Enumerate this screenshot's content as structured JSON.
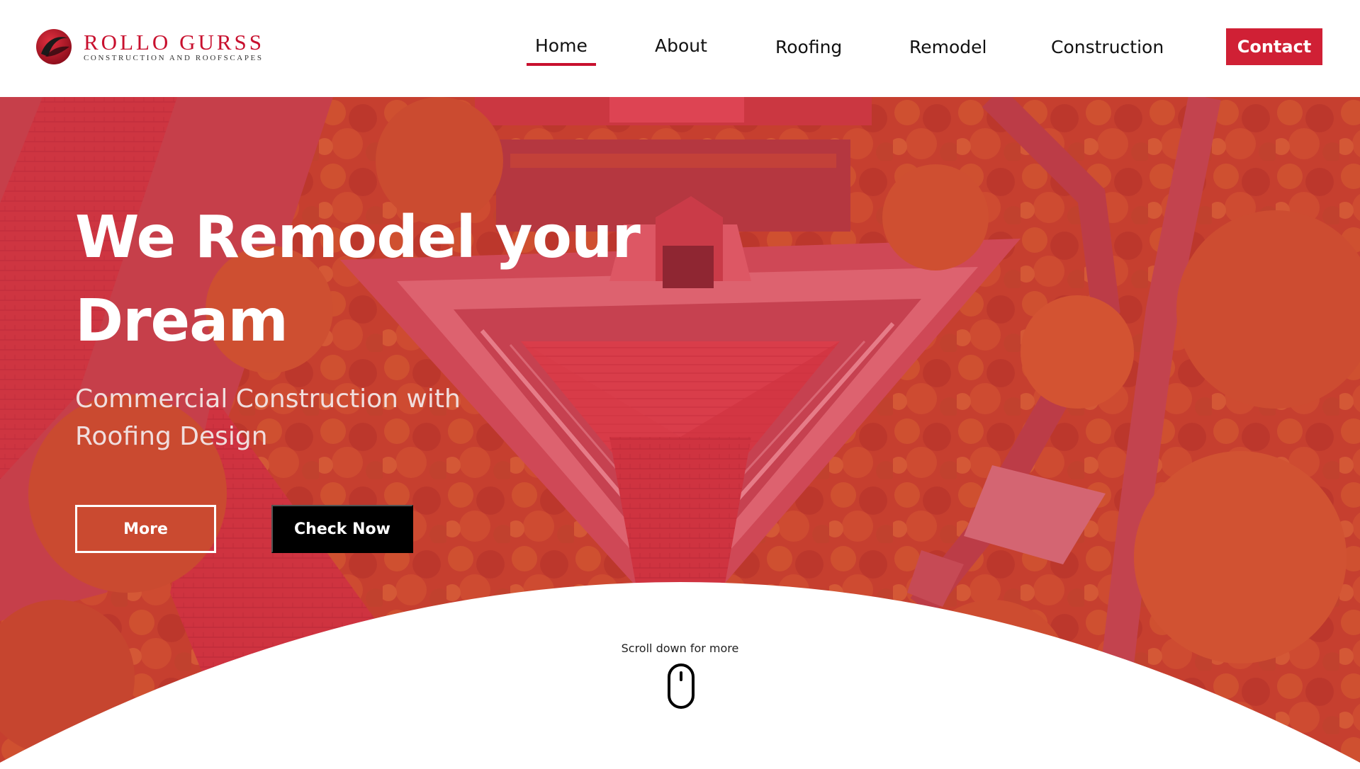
{
  "brand": {
    "name": "ROLLO GURSS",
    "tagline": "CONSTRUCTION AND ROOFSCAPES",
    "logo_icon": "logo-swoosh-icon",
    "color": "#c8102e"
  },
  "nav": {
    "items": [
      {
        "label": "Home",
        "active": true
      },
      {
        "label": "About",
        "active": false
      },
      {
        "label": "Roofing",
        "active": false
      },
      {
        "label": "Remodel",
        "active": false
      },
      {
        "label": "Construction",
        "active": false
      }
    ],
    "contact_label": "Contact",
    "contact_color": "#d02035"
  },
  "hero": {
    "title": "We Remodel your Dream",
    "subtitle": "Commercial Construction with Roofing Design",
    "more_label": "More",
    "check_label": "Check Now",
    "overlay_color": "#d9344a"
  },
  "scroll": {
    "text": "Scroll down for more",
    "icon": "mouse-icon"
  }
}
